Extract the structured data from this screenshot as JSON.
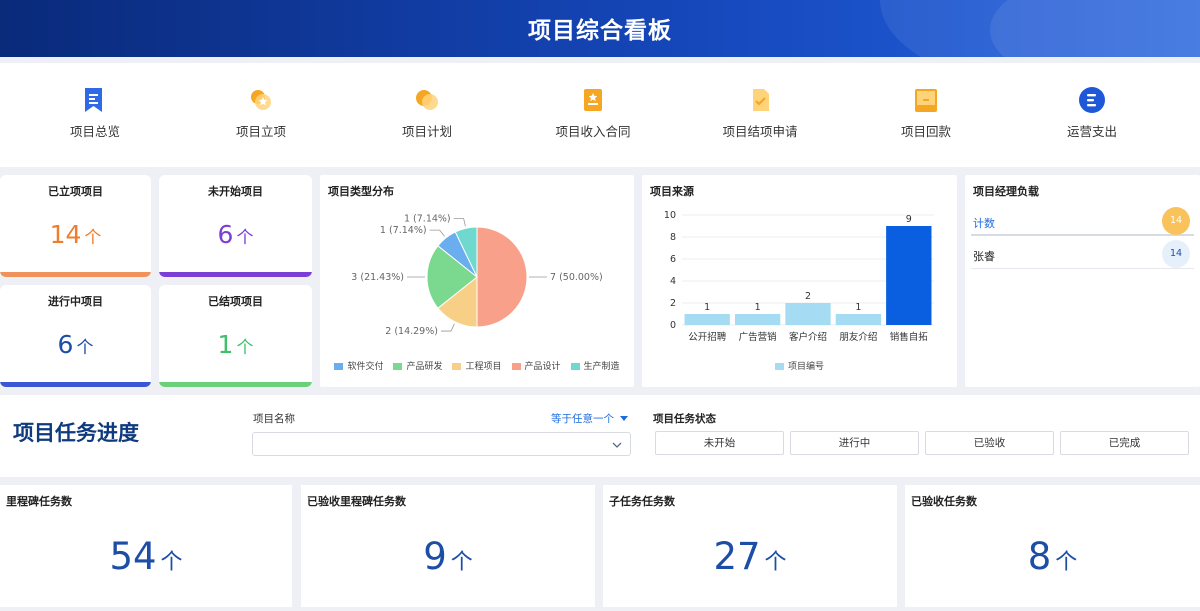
{
  "header": {
    "title": "项目综合看板"
  },
  "quick_links": [
    {
      "label": "项目总览",
      "icon": "document-flag-icon"
    },
    {
      "label": "项目立项",
      "icon": "coin-star-icon"
    },
    {
      "label": "项目计划",
      "icon": "coin-stack-icon"
    },
    {
      "label": "项目收入合同",
      "icon": "contract-star-icon"
    },
    {
      "label": "项目结项申请",
      "icon": "check-document-icon"
    },
    {
      "label": "项目回款",
      "icon": "folder-icon"
    },
    {
      "label": "运营支出",
      "icon": "list-circle-icon"
    }
  ],
  "stats": {
    "established": {
      "title": "已立项项目",
      "value": "14",
      "unit": "个",
      "color": "#f07d2c"
    },
    "not_started": {
      "title": "未开始项目",
      "value": "6",
      "unit": "个",
      "color": "#7b3fd6"
    },
    "in_progress": {
      "title": "进行中项目",
      "value": "6",
      "unit": "个",
      "color": "#1c4ea6"
    },
    "closed": {
      "title": "已结项项目",
      "value": "1",
      "unit": "个",
      "color": "#3fbf6c"
    }
  },
  "type_dist": {
    "title": "项目类型分布",
    "chart_data": {
      "type": "pie",
      "slices": [
        {
          "name": "产品设计",
          "value": 7,
          "label": "7 (50.00%)",
          "color": "#f8a08a"
        },
        {
          "name": "工程项目",
          "value": 2,
          "label": "2 (14.29%)",
          "color": "#f8cf86"
        },
        {
          "name": "产品研发",
          "value": 3,
          "label": "3 (21.43%)",
          "color": "#7bd88f"
        },
        {
          "name": "软件交付",
          "value": 1,
          "label": "1 (7.14%)",
          "color": "#6aaef0"
        },
        {
          "name": "生产制造",
          "value": 1,
          "label": "1 (7.14%)",
          "color": "#6fd8cf"
        }
      ],
      "legend": [
        "软件交付",
        "产品研发",
        "工程项目",
        "产品设计",
        "生产制造"
      ]
    }
  },
  "source": {
    "title": "项目来源",
    "chart_data": {
      "type": "bar",
      "categories": [
        "公开招聘",
        "广告营销",
        "客户介绍",
        "朋友介绍",
        "销售自拓"
      ],
      "series": [
        {
          "name": "项目编号",
          "values": [
            1,
            1,
            2,
            1,
            9
          ]
        }
      ],
      "ylim": [
        0,
        10
      ],
      "yticks": [
        0,
        2,
        4,
        6,
        8,
        10
      ],
      "bar_color": "#a6dcf3",
      "highlight_color": "#0a5fe0",
      "legend": "项目编号"
    }
  },
  "manager": {
    "title": "项目经理负载",
    "rows": [
      {
        "name": "计数",
        "value": "14",
        "badge_bg": "#f9c25a",
        "badge_fg": "#ffffff",
        "name_color": "#1c6be0"
      },
      {
        "name": "张睿",
        "value": "14",
        "badge_bg": "#e6f0fb",
        "badge_fg": "#1c4ea6",
        "name_color": "#222222"
      }
    ]
  },
  "filter": {
    "section_title": "项目任务进度",
    "name_label": "项目名称",
    "match_label": "等于任意一个",
    "select_value": "",
    "status_label": "项目任务状态",
    "status_options": [
      "未开始",
      "进行中",
      "已验收",
      "已完成"
    ]
  },
  "bottom": [
    {
      "title": "里程碑任务数",
      "value": "54",
      "unit": "个"
    },
    {
      "title": "已验收里程碑任务数",
      "value": "9",
      "unit": "个"
    },
    {
      "title": "子任务任务数",
      "value": "27",
      "unit": "个"
    },
    {
      "title": "已验收任务数",
      "value": "8",
      "unit": "个"
    }
  ]
}
